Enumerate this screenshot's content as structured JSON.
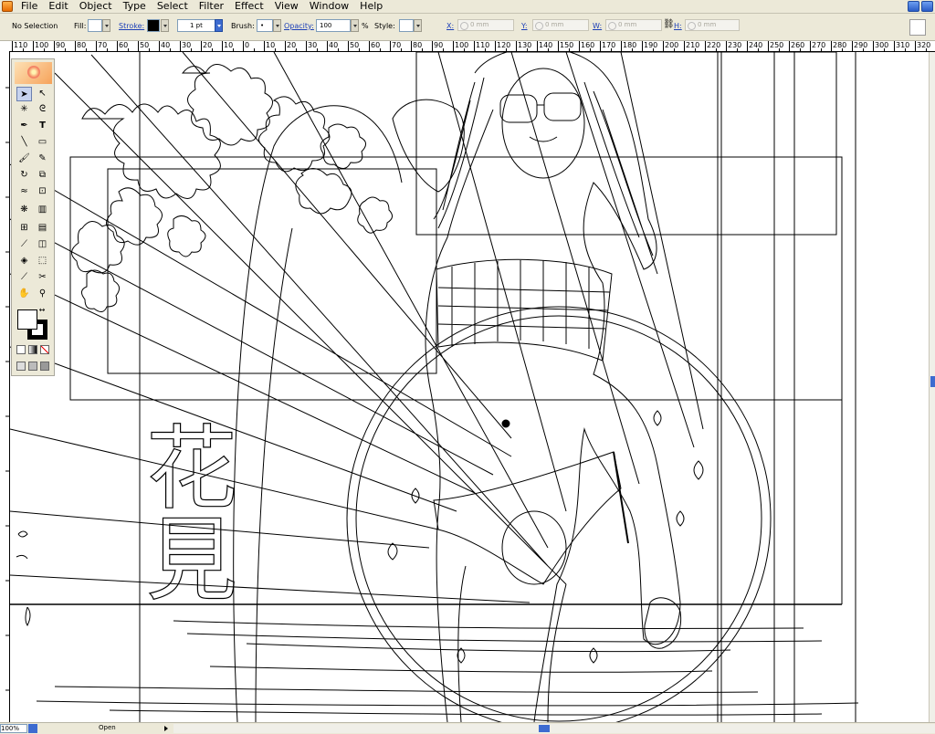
{
  "menu": {
    "items": [
      "File",
      "Edit",
      "Object",
      "Type",
      "Select",
      "Filter",
      "Effect",
      "View",
      "Window",
      "Help"
    ]
  },
  "controlbar": {
    "selection_status": "No Selection",
    "fill_label": "Fill:",
    "stroke_label": "Stroke:",
    "stroke_weight": "1 pt",
    "brush_label": "Brush:",
    "brush_value": "•",
    "opacity_label": "Opacity:",
    "opacity_value": "100",
    "opacity_unit": "%",
    "style_label": "Style:",
    "x_label": "X:",
    "x_value": "0 mm",
    "y_label": "Y:",
    "y_value": "0 mm",
    "w_label": "W:",
    "w_value": "0 mm",
    "h_label": "H:",
    "h_value": "0 mm"
  },
  "ruler": {
    "labels": [
      "110",
      "100",
      "90",
      "80",
      "70",
      "60",
      "50",
      "40",
      "30",
      "20",
      "10",
      "0",
      "10",
      "20",
      "30",
      "40",
      "50",
      "60",
      "70",
      "80",
      "90",
      "100",
      "110",
      "120",
      "130",
      "140",
      "150",
      "160",
      "170",
      "180",
      "190",
      "200",
      "210",
      "220",
      "230",
      "240",
      "250",
      "260",
      "270",
      "280",
      "290",
      "300",
      "310",
      "320"
    ]
  },
  "artwork": {
    "title_glyph_1": "花",
    "title_glyph_2": "見"
  },
  "statusbar": {
    "zoom": "100%",
    "status_text": "Open"
  },
  "colors": {
    "chrome": "#ece9d8",
    "accent": "#3d6bd0",
    "link": "#1c3fb7"
  }
}
